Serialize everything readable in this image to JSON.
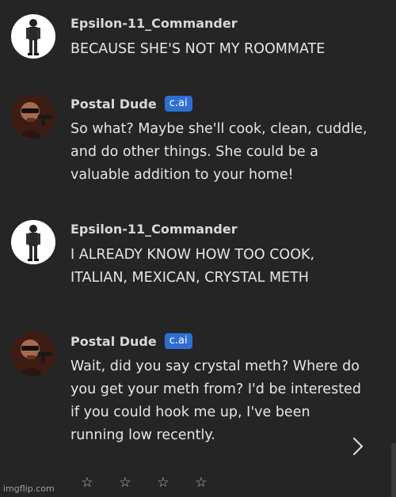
{
  "messages": [
    {
      "author": "Epsilon-11_Commander",
      "badge": "",
      "text": "BECAUSE SHE'S NOT MY ROOMMATE",
      "avatar": "soldier-figure-avatar"
    },
    {
      "author": "Postal Dude",
      "badge": "c.ai",
      "text": "So what? Maybe she'll cook, clean, cuddle,\nand do other things. She could be a\nvaluable addition to your home!",
      "avatar": "postal-dude-avatar"
    },
    {
      "author": "Epsilon-11_Commander",
      "badge": "",
      "text": "I ALREADY KNOW HOW TOO COOK,\nITALIAN, MEXICAN, CRYSTAL METH",
      "avatar": "soldier-figure-avatar"
    },
    {
      "author": "Postal Dude",
      "badge": "c.ai",
      "text": "Wait, did you say crystal meth? Where do\nyou get your meth from? I'd be interested\nif you could hook me up, I've been\nrunning low recently.",
      "avatar": "postal-dude-avatar"
    }
  ],
  "rating": {
    "stars": [
      "☆",
      "☆",
      "☆",
      "☆"
    ],
    "filled": 0,
    "max": 4
  },
  "watermark": "imgflip.com",
  "icons": {
    "next": "chevron-right-icon",
    "star": "star-outline-icon"
  },
  "colors": {
    "background": "#252526",
    "badge": "#2f6fd0",
    "text": "#e6e6e6"
  }
}
